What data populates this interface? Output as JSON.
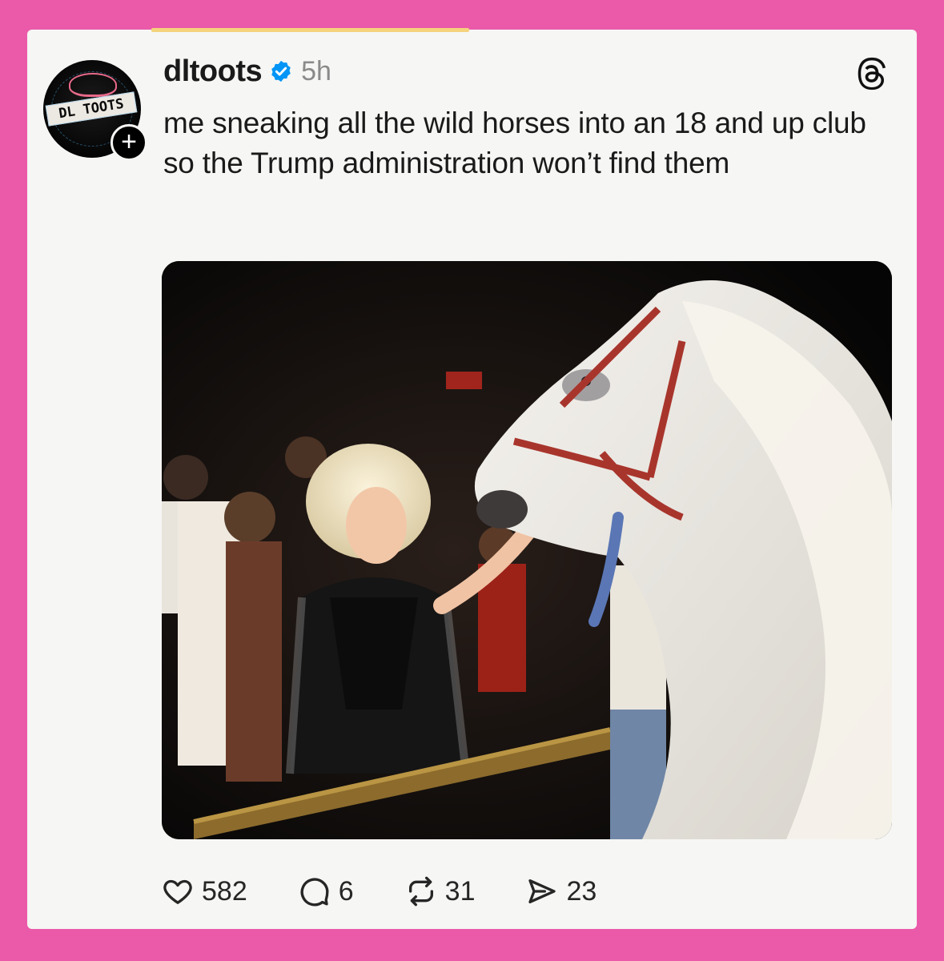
{
  "post": {
    "username": "dltoots",
    "time": "5h",
    "text": "me sneaking all the wild horses into an 18 and up club so the Trump administration won’t find them",
    "avatar_text": "DL TOOTS",
    "follow_symbol": "+"
  },
  "actions": {
    "likes": "582",
    "comments": "6",
    "reposts": "31",
    "shares": "23"
  },
  "icons": {
    "verified": "verified-badge-icon",
    "app": "threads-logo-icon",
    "like": "heart-icon",
    "comment": "comment-bubble-icon",
    "repost": "repost-arrows-icon",
    "share": "send-icon"
  },
  "colors": {
    "frame": "#ea5aa9",
    "card": "#f6f6f4",
    "verified": "#0095f6",
    "accent": "#f5d37d"
  }
}
